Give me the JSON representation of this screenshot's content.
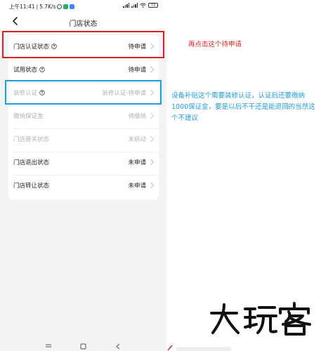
{
  "status_bar": {
    "time": "上午11:41",
    "speed": "5.7K/s",
    "battery": "73"
  },
  "nav": {
    "title": "门店状态"
  },
  "rows": [
    {
      "label": "门店认证状态",
      "value": "待申请",
      "help": true,
      "disabled": false
    },
    {
      "label": "试用状态",
      "value": "待申请",
      "help": true,
      "disabled": false
    },
    {
      "label": "装修认证",
      "value": "装修认证-待申请",
      "help": true,
      "disabled": true
    },
    {
      "label": "缴纳保证金",
      "value": "待缴纳",
      "help": false,
      "disabled": true
    },
    {
      "label": "门店营关状态",
      "value": "未启动",
      "help": false,
      "disabled": true
    },
    {
      "label": "门店退出状态",
      "value": "未申请",
      "help": false,
      "disabled": false
    },
    {
      "label": "门店转让状态",
      "value": "未申请",
      "help": false,
      "disabled": false
    }
  ],
  "annotations": {
    "red_note": "再点击这个待申请",
    "blue_note": "设备补贴这个需要装修认证，认证后还要缴纳1000保证金，要是以后不干还是能退回的当然这个不建议"
  },
  "watermark": {
    "text": "大玩客"
  },
  "colors": {
    "red": "#e02020",
    "blue": "#1f9bde",
    "disabled_text": "#b2b2b2",
    "page_bg": "#f2f3f5"
  }
}
